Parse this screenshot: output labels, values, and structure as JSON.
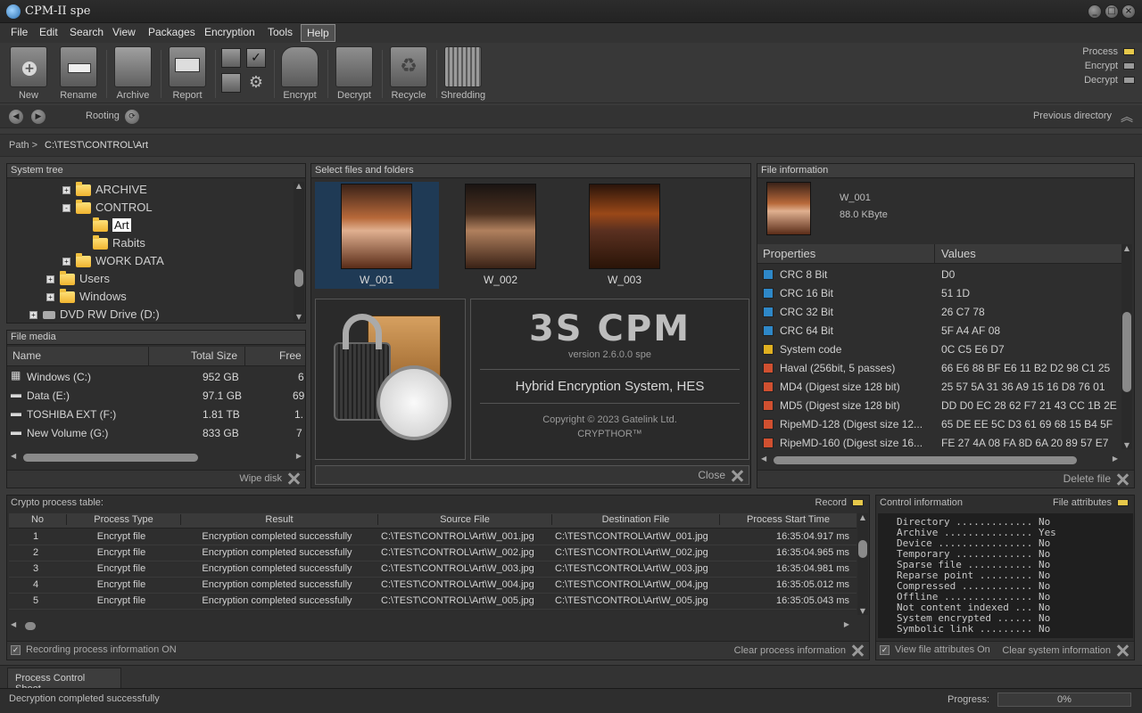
{
  "window": {
    "title": "CPM-II spe"
  },
  "menu": [
    "File",
    "Edit",
    "Search",
    "View",
    "Packages",
    "Encryption",
    "Tools",
    "Help"
  ],
  "toolbar": {
    "new": "New",
    "rename": "Rename",
    "archive": "Archive",
    "report": "Report",
    "encrypt": "Encrypt",
    "decrypt": "Decrypt",
    "recycle": "Recycle",
    "shredding": "Shredding"
  },
  "indicators": [
    {
      "label": "Process",
      "color": "#e6c84a"
    },
    {
      "label": "Encrypt",
      "color": "#9a9a9a"
    },
    {
      "label": "Decrypt",
      "color": "#9a9a9a"
    }
  ],
  "nav": {
    "rooting": "Rooting",
    "previous_directory": "Previous directory"
  },
  "path": {
    "label": "Path >",
    "value": "C:\\TEST\\CONTROL\\Art"
  },
  "system_tree": {
    "title": "System tree",
    "items": [
      {
        "label": "ARCHIVE",
        "expander": "+",
        "level": 3
      },
      {
        "label": "CONTROL",
        "expander": "-",
        "level": 3
      },
      {
        "label": "Art",
        "expander": "",
        "level": 4
      },
      {
        "label": "Rabits",
        "expander": "",
        "level": 4
      },
      {
        "label": "WORK DATA",
        "expander": "+",
        "level": 3
      },
      {
        "label": "Users",
        "expander": "+",
        "level": 2
      },
      {
        "label": "Windows",
        "expander": "+",
        "level": 2
      },
      {
        "label": "DVD RW Drive (D:)",
        "expander": "+",
        "level": 1
      }
    ]
  },
  "file_media": {
    "title": "File media",
    "columns": [
      "Name",
      "Total Size",
      "Free"
    ],
    "rows": [
      {
        "name": "Windows  (C:)",
        "total": "952 GB",
        "free": "6"
      },
      {
        "name": "Data (E:)",
        "total": "97.1 GB",
        "free": "69"
      },
      {
        "name": "TOSHIBA EXT (F:)",
        "total": "1.81 TB",
        "free": "1."
      },
      {
        "name": "New Volume (G:)",
        "total": "833 GB",
        "free": "7"
      }
    ],
    "wipe_disk": "Wipe disk"
  },
  "select_files": {
    "title": "Select files and folders",
    "files": [
      "W_001",
      "W_002",
      "W_003"
    ],
    "close": "Close"
  },
  "about": {
    "logo": "3S CPM",
    "version": "version 2.6.0.0 spe",
    "system": "Hybrid Encryption System, HES",
    "copyright": "Copyright © 2023 Gatelink Ltd.",
    "product": "CRYPTHOR™"
  },
  "file_info": {
    "title": "File information",
    "name": "W_001",
    "size": "88.0 KByte",
    "columns": [
      "Properties",
      "Values"
    ],
    "rows": [
      {
        "prop": "CRC 8 Bit",
        "value": "D0",
        "color": "#2e88c8"
      },
      {
        "prop": "CRC 16 Bit",
        "value": "51 1D",
        "color": "#2e88c8"
      },
      {
        "prop": "CRC 32 Bit",
        "value": "26 C7 78",
        "color": "#2e88c8"
      },
      {
        "prop": "CRC 64 Bit",
        "value": "5F A4 AF 08",
        "color": "#2e88c8"
      },
      {
        "prop": "System code",
        "value": "0C C5 E6 D7",
        "color": "#e0b020"
      },
      {
        "prop": "Haval (256bit, 5 passes)",
        "value": "66 E6 88 BF E6 11 B2 D2 98 C1 25",
        "color": "#d05030"
      },
      {
        "prop": "MD4 (Digest size 128 bit)",
        "value": "25 57 5A 31 36 A9 15 16 D8 76 01",
        "color": "#d05030"
      },
      {
        "prop": "MD5 (Digest size 128 bit)",
        "value": "DD D0 EC 28 62 F7 21 43 CC 1B 2E",
        "color": "#d05030"
      },
      {
        "prop": "RipeMD-128 (Digest size 12...",
        "value": "65 DE EE 5C D3 61 69 68 15 B4 5F",
        "color": "#d05030"
      },
      {
        "prop": "RipeMD-160 (Digest size 16...",
        "value": "FE 27 4A 08 FA 8D 6A 20 89 57 E7",
        "color": "#d05030"
      }
    ],
    "delete_file": "Delete file"
  },
  "crypto_table": {
    "title": "Crypto process table:",
    "record": "Record",
    "columns": [
      "No",
      "Process Type",
      "Result",
      "Source File",
      "Destination File",
      "Process Start Time"
    ],
    "rows": [
      {
        "no": "1",
        "type": "Encrypt file",
        "result": "Encryption completed successfully",
        "src": "C:\\TEST\\CONTROL\\Art\\W_001.jpg",
        "dst": "C:\\TEST\\CONTROL\\Art\\W_001.jpg",
        "time": "16:35:04.917 ms"
      },
      {
        "no": "2",
        "type": "Encrypt file",
        "result": "Encryption completed successfully",
        "src": "C:\\TEST\\CONTROL\\Art\\W_002.jpg",
        "dst": "C:\\TEST\\CONTROL\\Art\\W_002.jpg",
        "time": "16:35:04.965 ms"
      },
      {
        "no": "3",
        "type": "Encrypt file",
        "result": "Encryption completed successfully",
        "src": "C:\\TEST\\CONTROL\\Art\\W_003.jpg",
        "dst": "C:\\TEST\\CONTROL\\Art\\W_003.jpg",
        "time": "16:35:04.981 ms"
      },
      {
        "no": "4",
        "type": "Encrypt file",
        "result": "Encryption completed successfully",
        "src": "C:\\TEST\\CONTROL\\Art\\W_004.jpg",
        "dst": "C:\\TEST\\CONTROL\\Art\\W_004.jpg",
        "time": "16:35:05.012 ms"
      },
      {
        "no": "5",
        "type": "Encrypt file",
        "result": "Encryption completed successfully",
        "src": "C:\\TEST\\CONTROL\\Art\\W_005.jpg",
        "dst": "C:\\TEST\\CONTROL\\Art\\W_005.jpg",
        "time": "16:35:05.043 ms"
      }
    ],
    "recording": "Recording process information ON",
    "clear": "Clear process information"
  },
  "control_info": {
    "title": "Control information",
    "file_attributes": "File attributes",
    "lines": [
      "Directory ............. No",
      "Archive ............... Yes",
      "Device ................ No",
      "Temporary ............. No",
      "Sparse file ........... No",
      "Reparse point ......... No",
      "Compressed ............ No",
      "Offline ............... No",
      "Not content indexed ... No",
      "System encrypted ...... No",
      "Symbolic link ......... No"
    ],
    "view_attr": "View file attributes On",
    "clear": "Clear system information"
  },
  "tabs": {
    "process_control": "Process Control Sheet"
  },
  "status": {
    "message": "Decryption completed successfully",
    "progress_label": "Progress:",
    "progress_value": "0%",
    "progress": 0
  }
}
